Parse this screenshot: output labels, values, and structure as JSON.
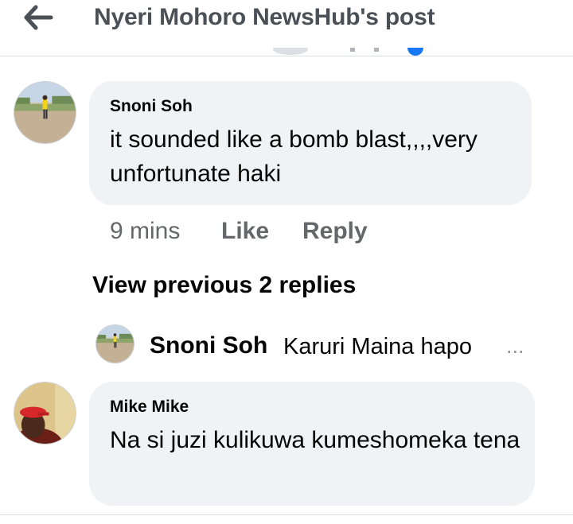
{
  "header": {
    "title": "Nyeri Mohoro NewsHub's post",
    "back_icon": "arrow-left-icon"
  },
  "comments": [
    {
      "author": "Snoni Soh",
      "text": "it sounded like a bomb blast,,,,very unfortunate haki",
      "time": "9 mins",
      "like_label": "Like",
      "reply_label": "Reply"
    },
    {
      "author": "Mike Mike",
      "text": "Na si juzi kulikuwa kumeshomeka tena"
    }
  ],
  "replies": {
    "view_previous_label": "View previous 2 replies",
    "preview_author": "Snoni Soh",
    "preview_text": "Karuri Maina hapo",
    "ellipsis": "..."
  },
  "colors": {
    "bubble": "#f0f2f5",
    "secondary_text": "#65676b",
    "header_text": "#4b4f56",
    "accent": "#1877f2"
  }
}
